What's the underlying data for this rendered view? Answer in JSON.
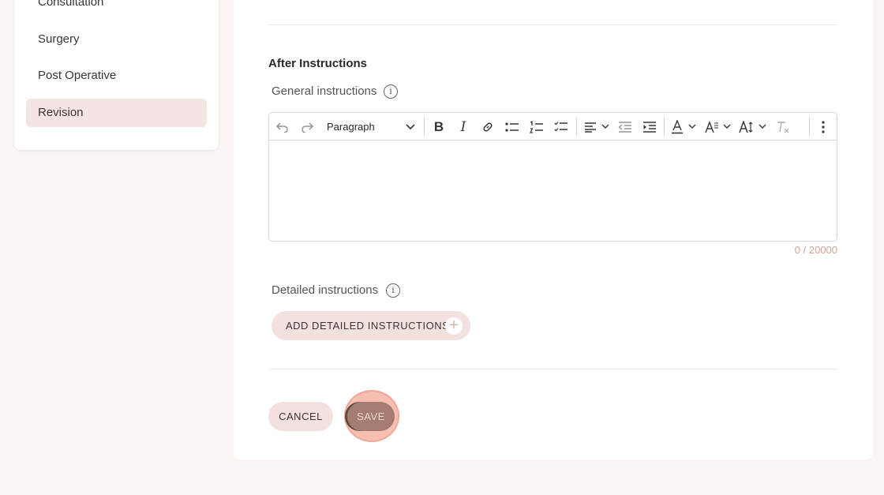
{
  "sidebar": {
    "items": [
      {
        "label": "Consultation"
      },
      {
        "label": "Surgery"
      },
      {
        "label": "Post Operative"
      },
      {
        "label": "Revision"
      }
    ]
  },
  "section": {
    "title": "After Instructions",
    "general_label": "General instructions",
    "detailed_label": "Detailed instructions"
  },
  "editor": {
    "block_format": "Paragraph",
    "counter": "0 / 20000",
    "value": ""
  },
  "buttons": {
    "add_detailed": "ADD DETAILED INSTRUCTIONS",
    "cancel": "CANCEL",
    "save": "SAVE"
  },
  "colors": {
    "accent_light": "#f3e1df",
    "save_bg": "#a47c72",
    "counter_text": "#d1a394",
    "focus_ring": "#f6bfb2"
  }
}
